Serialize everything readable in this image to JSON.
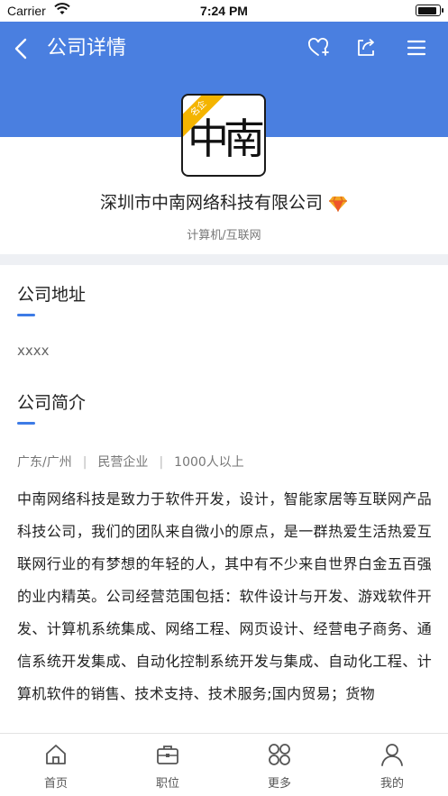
{
  "status_bar": {
    "carrier": "Carrier",
    "time": "7:24 PM"
  },
  "header": {
    "title": "公司详情",
    "background_color": "#4a7fe0",
    "icons": [
      "back-arrow-icon",
      "heart-plus-icon",
      "share-icon",
      "menu-icon"
    ]
  },
  "company": {
    "logo_text": "中南",
    "badge": "名企",
    "name": "深圳市中南网络科技有限公司",
    "industry": "计算机/互联网",
    "gem_icon": "diamond-icon"
  },
  "address_section": {
    "title": "公司地址",
    "value": "xxxx",
    "accent_color": "#3d7be6"
  },
  "intro_section": {
    "title": "公司简介",
    "meta": {
      "location": "广东/广州",
      "type": "民营企业",
      "size": "1000人以上"
    },
    "text": "中南网络科技是致力于软件开发，设计，智能家居等互联网产品科技公司，我们的团队来自微小的原点，是一群热爱生活热爱互联网行业的有梦想的年轻的人，其中有不少来自世界白金五百强的业内精英。公司经营范围包括：软件设计与开发、游戏软件开发、计算机系统集成、网络工程、网页设计、经营电子商务、通信系统开发集成、自动化控制系统开发与集成、自动化工程、计算机软件的销售、技术支持、技术服务;国内贸易；货物"
  },
  "tabbar": {
    "tabs": [
      {
        "label": "首页",
        "icon": "home-icon"
      },
      {
        "label": "职位",
        "icon": "briefcase-icon"
      },
      {
        "label": "更多",
        "icon": "more-grid-icon"
      },
      {
        "label": "我的",
        "icon": "user-icon"
      }
    ]
  }
}
